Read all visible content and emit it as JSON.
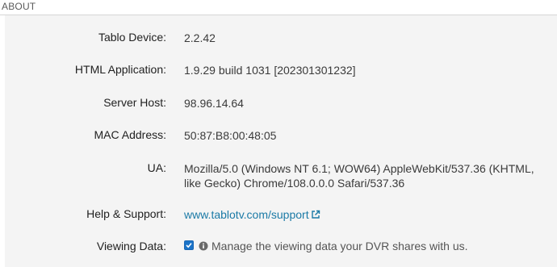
{
  "header": {
    "title": "ABOUT"
  },
  "rows": [
    {
      "label": "Tablo Device:",
      "value": "2.2.42"
    },
    {
      "label": "HTML Application:",
      "value": "1.9.29 build 1031 [202301301232]"
    },
    {
      "label": "Server Host:",
      "value": "98.96.14.64"
    },
    {
      "label": "MAC Address:",
      "value": "50:87:B8:00:48:05"
    },
    {
      "label": "UA:",
      "value": "Mozilla/5.0 (Windows NT 6.1; WOW64) AppleWebKit/537.36 (KHTML, like Gecko) Chrome/108.0.0.0 Safari/537.36"
    },
    {
      "label": "Help & Support:",
      "value": "www.tablotv.com/support"
    },
    {
      "label": "Viewing Data:",
      "value": "Manage the viewing data your DVR shares with us."
    }
  ],
  "icons": {
    "external_link": "external-link-icon",
    "info": "info-icon",
    "checkbox": "checkbox-checked"
  },
  "viewing_data": {
    "checked": true
  },
  "colors": {
    "link": "#1b7aa6",
    "checkbox": "#1a73c8",
    "panel_bg": "#f4f4f4"
  }
}
